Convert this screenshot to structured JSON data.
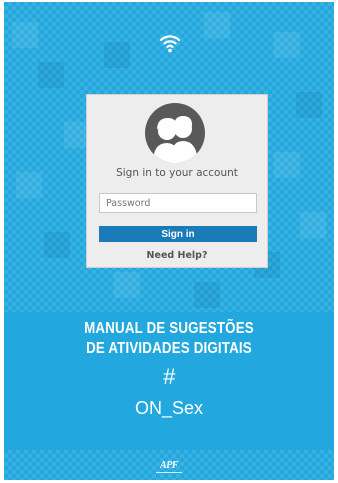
{
  "login": {
    "prompt": "Sign in to your account",
    "password_placeholder": "Password",
    "signin_label": "Sign in",
    "help_label": "Need Help?"
  },
  "cover": {
    "title_line1": "MANUAL DE SUGESTÕES",
    "title_line2": "DE ATIVIDADES DIGITAIS",
    "hashtag": "#",
    "subtitle": "ON_Sex",
    "logo_text": "APF"
  },
  "icons": {
    "wifi": "wifi-icon",
    "avatar": "couple-avatar-icon"
  },
  "colors": {
    "background": "#22a8de",
    "card": "#ededed",
    "button": "#1b7ab8"
  }
}
